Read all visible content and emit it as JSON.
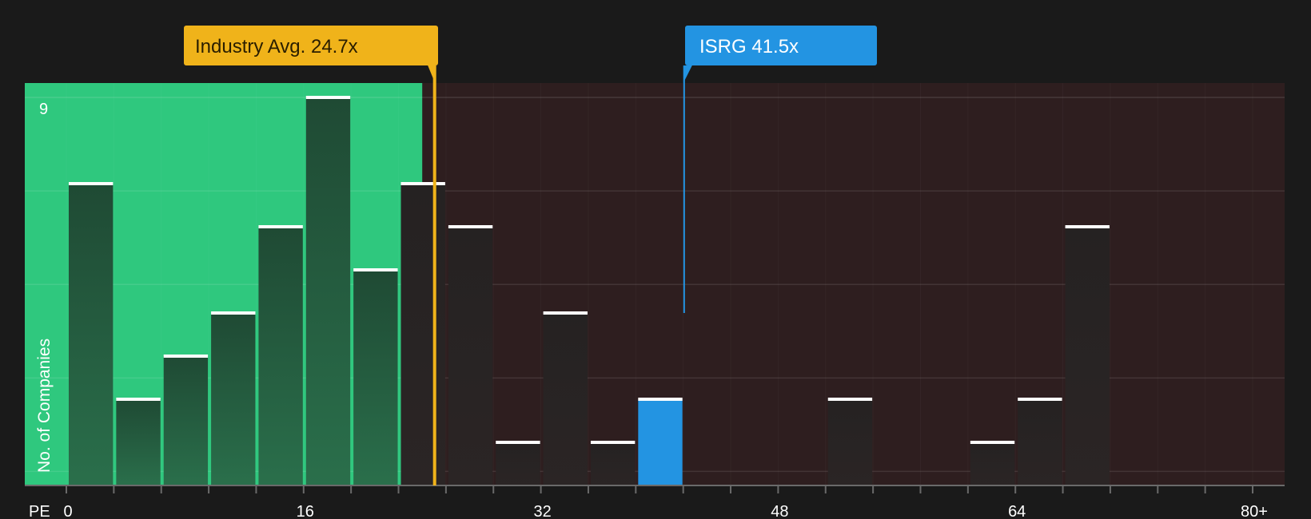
{
  "chart_data": {
    "type": "bar",
    "xlabel": "PE",
    "ylabel": "No. of Companies",
    "bin_width": 3.2,
    "x_range": [
      0,
      80
    ],
    "bins_start": [
      0,
      3.2,
      6.4,
      9.6,
      12.8,
      16,
      19.2,
      22.4,
      25.6,
      28.8,
      32,
      35.2,
      38.4,
      41.6,
      44.8,
      48,
      51.2,
      54.4,
      57.6,
      60.8,
      64,
      67.2,
      70.4,
      73.6,
      76.8,
      80
    ],
    "values": [
      7,
      2,
      3,
      4,
      6,
      9,
      5,
      7,
      6,
      1,
      4,
      1,
      2,
      0,
      0,
      0,
      2,
      0,
      0,
      1,
      2,
      6
    ],
    "bar_x": [
      0,
      3.2,
      6.4,
      9.6,
      12.8,
      16,
      19.2,
      22.4,
      25.6,
      28.8,
      32,
      35.2,
      38.4,
      41.6,
      44.8,
      48,
      51.2,
      54.4,
      57.6,
      60.8,
      64,
      67.2
    ],
    "ylim": [
      0,
      9
    ],
    "y_ticks": [
      9
    ],
    "x_ticks": [
      {
        "value": 0,
        "label": "0"
      },
      {
        "value": 16,
        "label": "16"
      },
      {
        "value": 32,
        "label": "32"
      },
      {
        "value": 48,
        "label": "48"
      },
      {
        "value": 64,
        "label": "64"
      },
      {
        "value": 80,
        "label": "80+"
      }
    ],
    "highlight_value": 41.5,
    "industry_avg_value": 24.7,
    "green_zone_end": 24.0
  },
  "callouts": {
    "industry": {
      "label": "Industry Avg. 24.7x",
      "value": 24.7,
      "color": "#f0b31a"
    },
    "company": {
      "label": "ISRG 41.5x",
      "value": 41.5,
      "color": "#2394e2"
    }
  },
  "colors": {
    "background": "#1a1a1a",
    "green_zone": "#2fc87e",
    "red_zone": "#2e1e1f",
    "bar_in_green": "#22563a",
    "bar_dark": "#232020",
    "highlight_bar": "#2394e2",
    "bar_cap": "#ffffff"
  }
}
